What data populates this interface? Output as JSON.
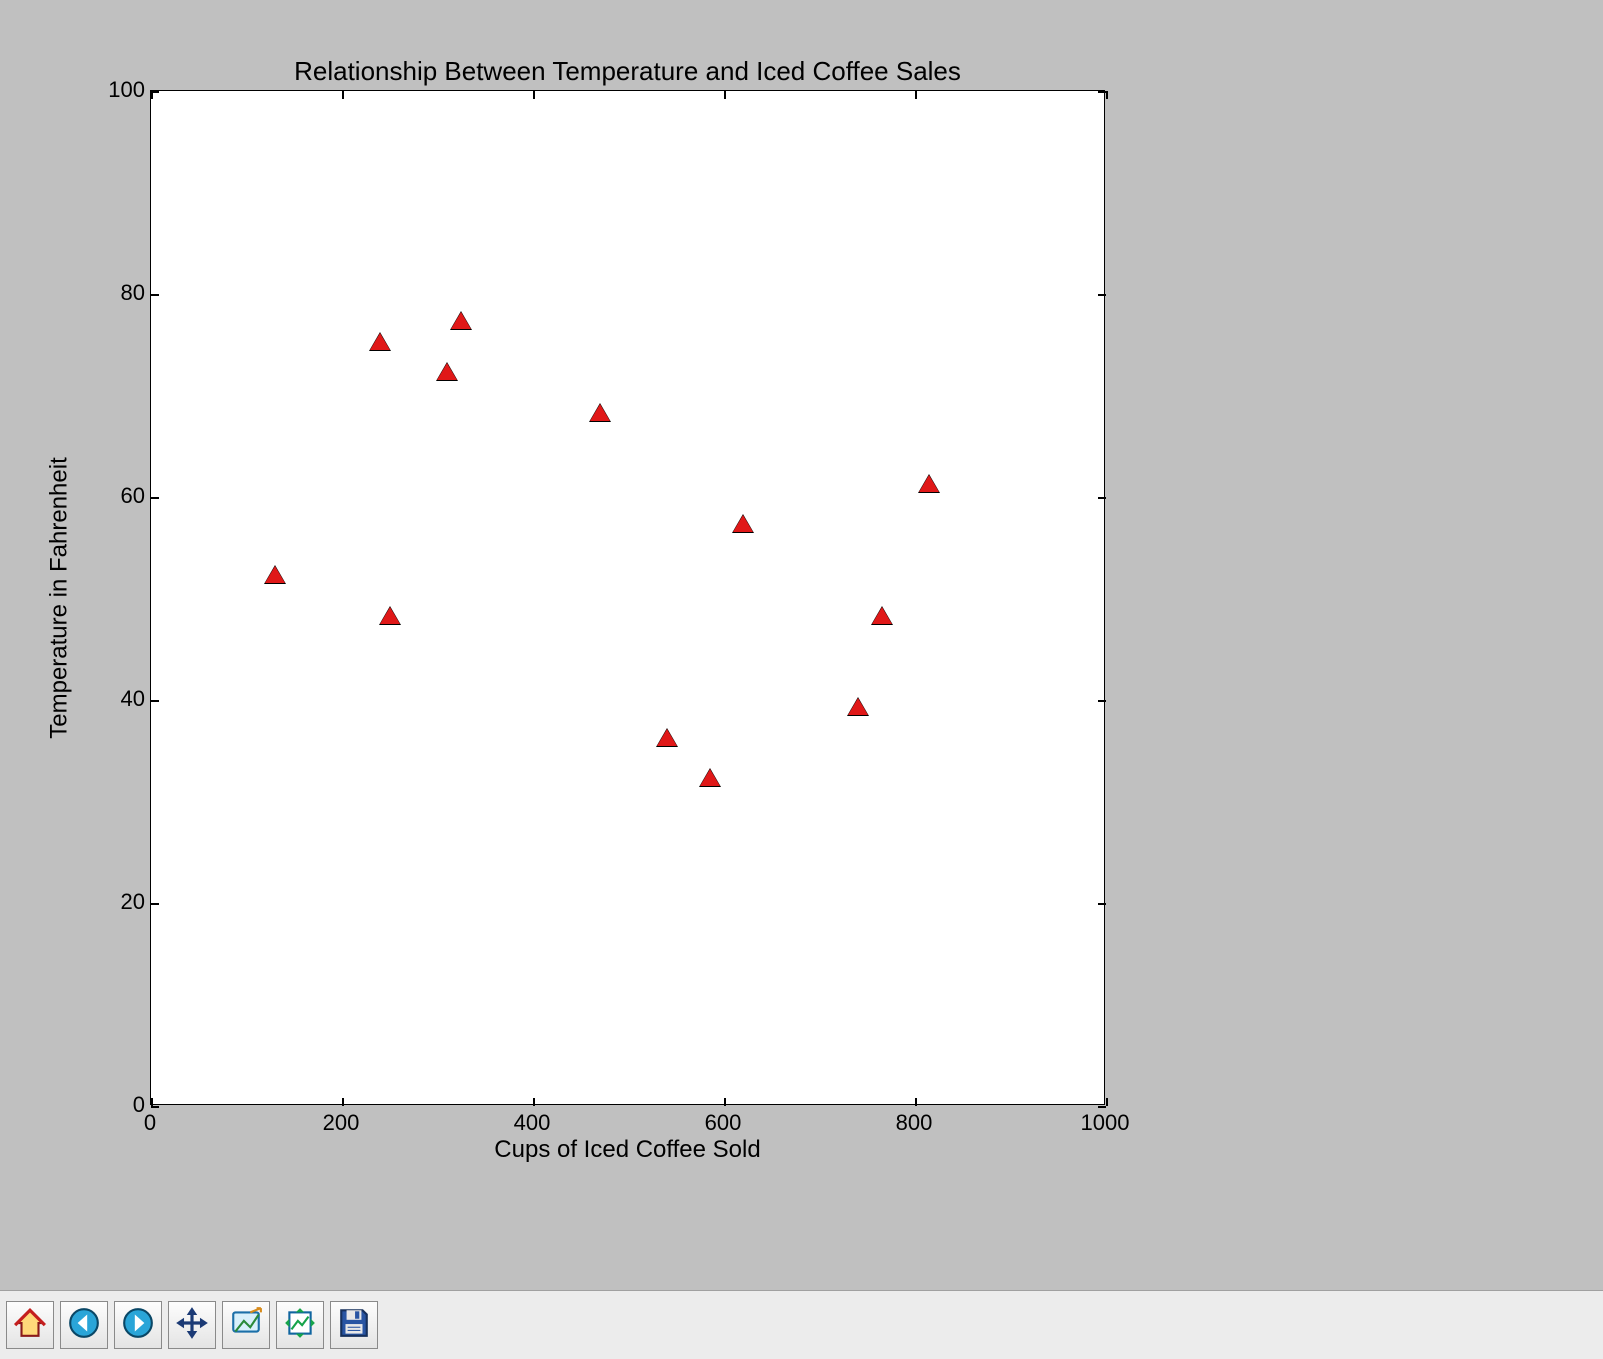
{
  "chart_data": {
    "type": "scatter",
    "title": "Relationship Between Temperature and Iced Coffee Sales",
    "xlabel": "Cups of Iced Coffee Sold",
    "ylabel": "Temperature in Fahrenheit",
    "xlim": [
      0,
      1000
    ],
    "ylim": [
      0,
      100
    ],
    "xticks": [
      0,
      200,
      400,
      600,
      800,
      1000
    ],
    "yticks": [
      0,
      20,
      40,
      60,
      80,
      100
    ],
    "marker": {
      "shape": "triangle",
      "fill": "#e01818",
      "edge": "#000000"
    },
    "points": [
      {
        "x": 130,
        "y": 52
      },
      {
        "x": 240,
        "y": 75
      },
      {
        "x": 250,
        "y": 48
      },
      {
        "x": 310,
        "y": 72
      },
      {
        "x": 325,
        "y": 77
      },
      {
        "x": 470,
        "y": 68
      },
      {
        "x": 540,
        "y": 36
      },
      {
        "x": 585,
        "y": 32
      },
      {
        "x": 620,
        "y": 57
      },
      {
        "x": 740,
        "y": 39
      },
      {
        "x": 765,
        "y": 48
      },
      {
        "x": 815,
        "y": 61
      }
    ]
  },
  "toolbar": {
    "buttons": [
      {
        "name": "home-button",
        "icon": "home-icon"
      },
      {
        "name": "back-button",
        "icon": "arrow-left-icon"
      },
      {
        "name": "forward-button",
        "icon": "arrow-right-icon"
      },
      {
        "name": "pan-button",
        "icon": "move-icon"
      },
      {
        "name": "zoom-button",
        "icon": "zoom-rect-icon"
      },
      {
        "name": "subplots-button",
        "icon": "subplots-icon"
      },
      {
        "name": "save-button",
        "icon": "save-icon"
      }
    ]
  }
}
